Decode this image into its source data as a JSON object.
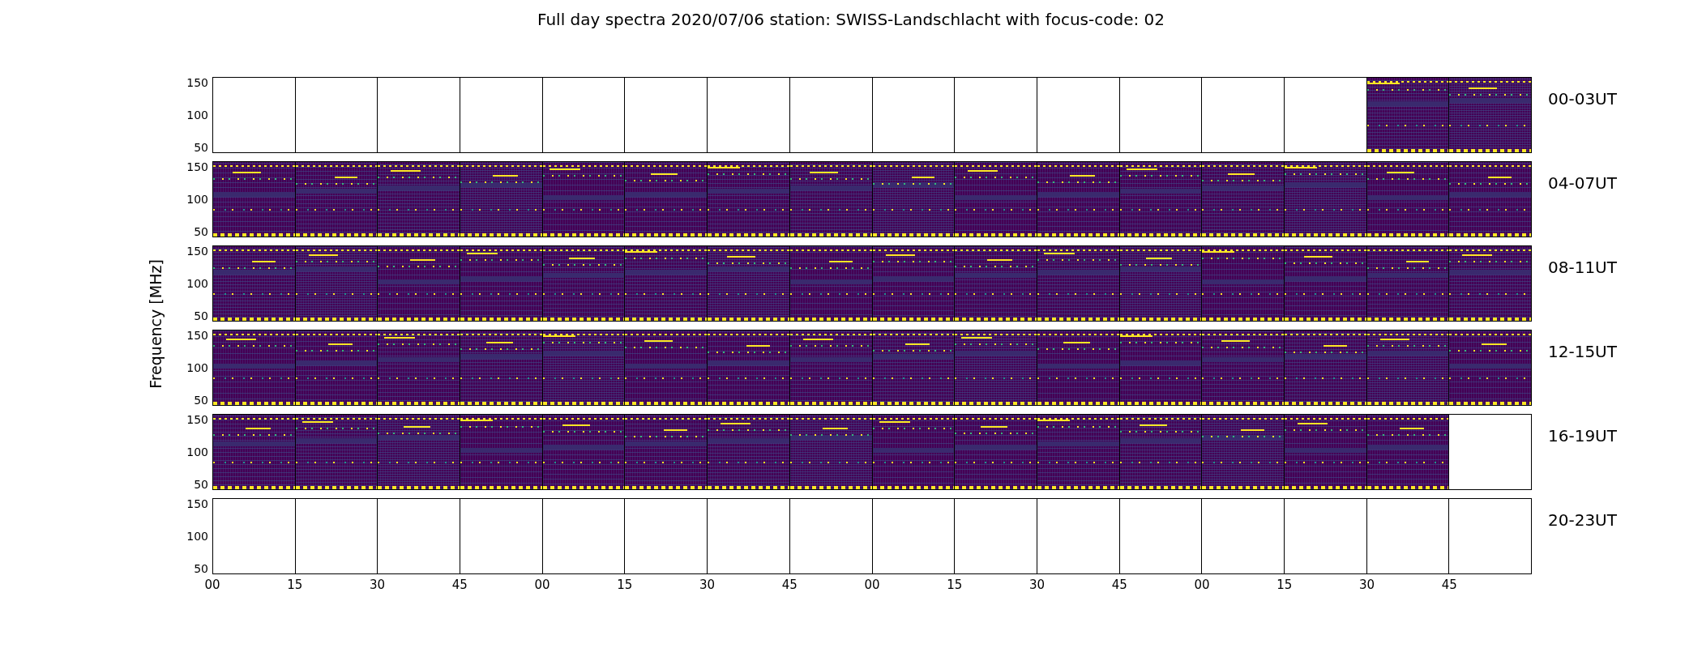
{
  "title": "Full day spectra 2020/07/06 station: SWISS-Landschlacht with focus-code: 02",
  "ylabel": "Frequency [MHz]",
  "rows": [
    {
      "label": "00-03UT",
      "yticks": [
        "150",
        "100",
        "50"
      ],
      "panels": [
        false,
        false,
        false,
        false,
        false,
        false,
        false,
        false,
        false,
        false,
        false,
        false,
        false,
        false,
        true,
        true
      ]
    },
    {
      "label": "04-07UT",
      "yticks": [
        "150",
        "100",
        "50"
      ],
      "panels": [
        true,
        true,
        true,
        true,
        true,
        true,
        true,
        true,
        true,
        true,
        true,
        true,
        true,
        true,
        true,
        true
      ]
    },
    {
      "label": "08-11UT",
      "yticks": [
        "150",
        "100",
        "50"
      ],
      "panels": [
        true,
        true,
        true,
        true,
        true,
        true,
        true,
        true,
        true,
        true,
        true,
        true,
        true,
        true,
        true,
        true
      ]
    },
    {
      "label": "12-15UT",
      "yticks": [
        "150",
        "100",
        "50"
      ],
      "panels": [
        true,
        true,
        true,
        true,
        true,
        true,
        true,
        true,
        true,
        true,
        true,
        true,
        true,
        true,
        true,
        true
      ]
    },
    {
      "label": "16-19UT",
      "yticks": [
        "150",
        "100",
        "50"
      ],
      "panels": [
        true,
        true,
        true,
        true,
        true,
        true,
        true,
        true,
        true,
        true,
        true,
        true,
        true,
        true,
        true,
        false
      ]
    },
    {
      "label": "20-23UT",
      "yticks": [
        "150",
        "100",
        "50"
      ],
      "panels": [
        false,
        false,
        false,
        false,
        false,
        false,
        false,
        false,
        false,
        false,
        false,
        false,
        false,
        false,
        false,
        false
      ]
    }
  ],
  "xticks": [
    "00",
    "15",
    "30",
    "45",
    "00",
    "15",
    "30",
    "45",
    "00",
    "15",
    "30",
    "45",
    "00",
    "15",
    "30",
    "45"
  ]
}
